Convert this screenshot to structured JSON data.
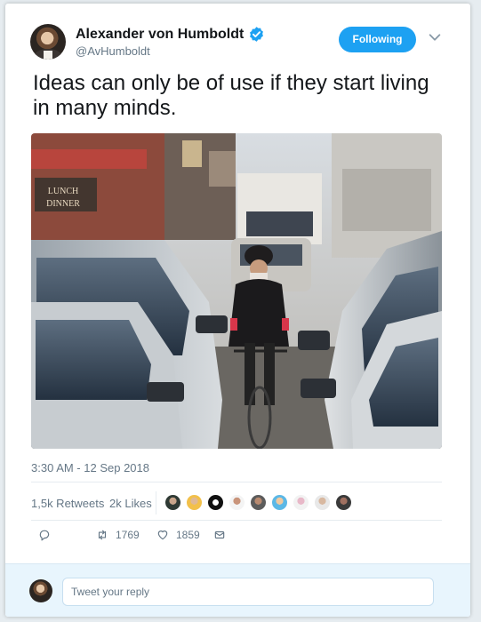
{
  "tweet": {
    "author_name": "Alexander von Humboldt",
    "handle": "@AvHumboldt",
    "follow_label": "Following",
    "text": "Ideas can only be of use if they start living in many minds.",
    "timestamp": "3:30 AM - 12 Sep 2018"
  },
  "stats": {
    "retweets_label": "1,5k Retweets",
    "likes_label": "2k Likes"
  },
  "actions": {
    "retweet_count": "1769",
    "like_count": "1859"
  },
  "reply": {
    "placeholder": "Tweet your reply"
  },
  "colors": {
    "accent": "#1da1f2",
    "muted_text": "#657786",
    "reply_bar_bg": "#e8f5fd"
  },
  "icons": {
    "verified": "verified-badge-icon",
    "caret": "chevron-down-icon",
    "reply": "reply-icon",
    "retweet": "retweet-icon",
    "like": "heart-icon",
    "dm": "envelope-icon"
  }
}
